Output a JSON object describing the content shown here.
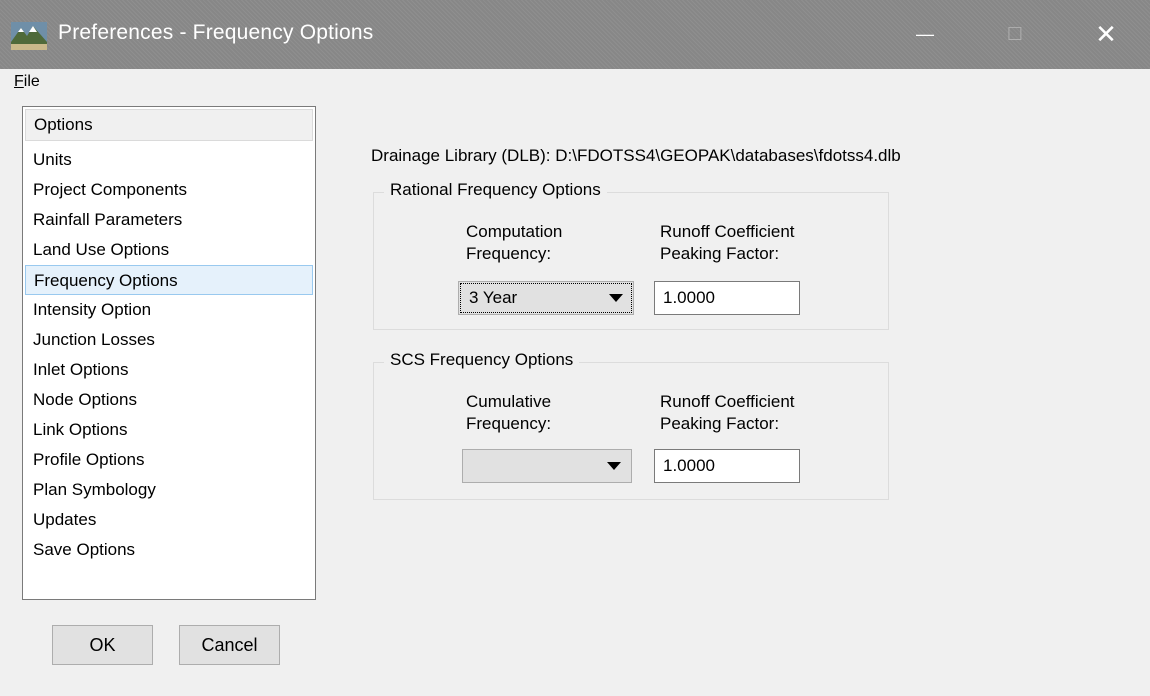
{
  "window": {
    "title": "Preferences - Frequency Options",
    "minimize_symbol": "—",
    "maximize_symbol": "☐",
    "close_symbol": "✕"
  },
  "menu": {
    "file_label_underlined": "F",
    "file_label_rest": "ile"
  },
  "sidebar": {
    "header": "Options",
    "items": [
      "Units",
      "Project Components",
      "Rainfall Parameters",
      "Land Use Options",
      "Frequency Options",
      "Intensity Option",
      "Junction Losses",
      "Inlet Options",
      "Node Options",
      "Link Options",
      "Profile Options",
      "Plan Symbology",
      "Updates",
      "Save Options"
    ],
    "selected": "Frequency Options"
  },
  "buttons": {
    "ok": "OK",
    "cancel": "Cancel"
  },
  "main": {
    "dlb_label": "Drainage Library (DLB): D:\\FDOTSS4\\GEOPAK\\databases\\fdotss4.dlb",
    "rational": {
      "title": "Rational Frequency Options",
      "freq_label_line1": "Computation",
      "freq_label_line2": "Frequency:",
      "coef_label_line1": "Runoff Coefficient",
      "coef_label_line2": "Peaking Factor:",
      "freq_value": "3 Year",
      "coef_value": "1.0000"
    },
    "scs": {
      "title": "SCS Frequency Options",
      "freq_label_line1": "Cumulative",
      "freq_label_line2": "Frequency:",
      "coef_label_line1": "Runoff Coefficient",
      "coef_label_line2": "Peaking Factor:",
      "freq_value": "",
      "coef_value": "1.0000"
    }
  },
  "colors": {
    "titlebar": "#8b8b8b",
    "selection_bg": "#e5f1fb",
    "selection_border": "#99c9ef"
  },
  "icons": {
    "app": "landscape-app-icon",
    "dropdown": "chevron-down-icon"
  }
}
